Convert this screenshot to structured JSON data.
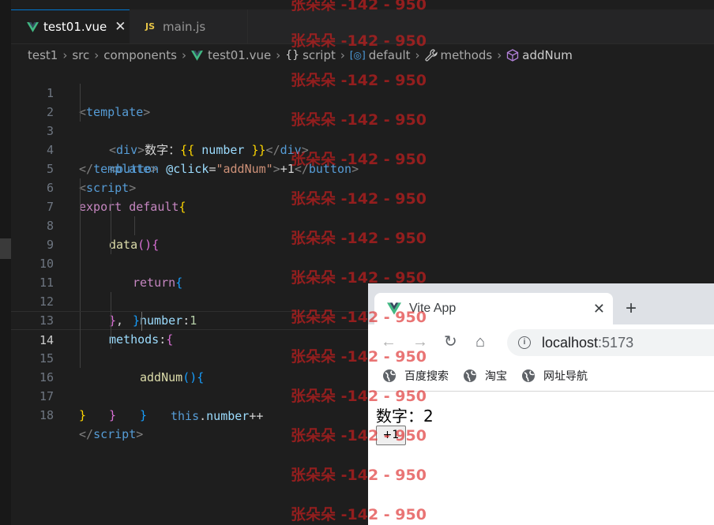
{
  "editor": {
    "tabs": [
      {
        "label": "test01.vue",
        "icon": "vue-icon",
        "active": true
      },
      {
        "label": "main.js",
        "icon": "js-icon",
        "active": false
      }
    ],
    "js_badge": "JS",
    "close_glyph": "✕",
    "breadcrumb": [
      {
        "label": "test1",
        "icon": ""
      },
      {
        "label": "src",
        "icon": ""
      },
      {
        "label": "components",
        "icon": ""
      },
      {
        "label": "test01.vue",
        "icon": "vue-icon"
      },
      {
        "label": "script",
        "icon": "braces-icon",
        "glyph": "{}"
      },
      {
        "label": "default",
        "icon": "module-icon",
        "glyph": "[◎]"
      },
      {
        "label": "methods",
        "icon": "wrench-icon",
        "glyph": "🔧"
      },
      {
        "label": "addNum",
        "icon": "cube-icon",
        "glyph": "⬡"
      }
    ],
    "current_line": 14,
    "lines": [
      {
        "n": "1"
      },
      {
        "n": "2"
      },
      {
        "n": "3"
      },
      {
        "n": "4"
      },
      {
        "n": "5"
      },
      {
        "n": "6"
      },
      {
        "n": "7"
      },
      {
        "n": "8"
      },
      {
        "n": "9"
      },
      {
        "n": "10"
      },
      {
        "n": "11"
      },
      {
        "n": "12"
      },
      {
        "n": "13"
      },
      {
        "n": "14"
      },
      {
        "n": "15"
      },
      {
        "n": "16"
      },
      {
        "n": "17"
      },
      {
        "n": "18"
      }
    ],
    "code": {
      "l1": {
        "open": "<",
        "tag": "template",
        "close": ">"
      },
      "l2": {
        "open": "<",
        "tag": "div",
        "gt": ">",
        "text": "数字：",
        "mo": "{{",
        "var": " number ",
        "mc": "}}",
        "endopen": "</",
        "endtag": "div",
        "endclose": ">"
      },
      "l3": {
        "open": "<",
        "tag": "button",
        "attr": " @click",
        "eq": "=",
        "val": "\"addNum\"",
        "gt": ">",
        "text": "+1",
        "endopen": "</",
        "endtag": "button",
        "endclose": ">"
      },
      "l4": {
        "open": "</",
        "tag": "template",
        "close": ">"
      },
      "l5": {
        "open": "<",
        "tag": "script",
        "close": ">"
      },
      "l6": {
        "kw": "export",
        "kw2": " default",
        "brace": "{"
      },
      "l7": {
        "fn": "data",
        "paren": "()",
        "brace": "{"
      },
      "l8": {
        "kw": "return",
        "brace": "{"
      },
      "l9": {
        "key": "number",
        "colon": ":",
        "num": "1"
      },
      "l10": {
        "brace": "}"
      },
      "l11": {
        "brace": "}",
        "comma": ","
      },
      "l12": {
        "key": "methods",
        "colon": ":",
        "brace": "{"
      },
      "l13": {
        "fn": "addNum",
        "paren": "()",
        "brace": "{"
      },
      "l14": {
        "kw": "this",
        "dot": ".",
        "var": "number",
        "op": "++"
      },
      "l15": {
        "brace": "}"
      },
      "l16": {
        "brace": "}"
      },
      "l17": {
        "brace": "}"
      },
      "l18": {
        "open": "</",
        "tag": "script",
        "close": ">"
      }
    }
  },
  "browser": {
    "tab_title": "Vite App",
    "tab_close": "✕",
    "new_tab": "+",
    "back": "←",
    "forward": "→",
    "reload": "↻",
    "home": "⌂",
    "info": "i",
    "url_host": "localhost",
    "url_port": ":5173",
    "bookmarks": [
      "百度搜索",
      "淘宝",
      "网址导航"
    ],
    "page_text": "数字：2",
    "page_button": "+1"
  },
  "watermark": {
    "text": "张朵朵 -142 - 950",
    "color": "#dc1e1e"
  },
  "colors": {
    "editor_bg": "#1e1e1e",
    "tab_active_border": "#0078d4",
    "vue_green": "#41b883",
    "js_yellow": "#e8c547"
  }
}
